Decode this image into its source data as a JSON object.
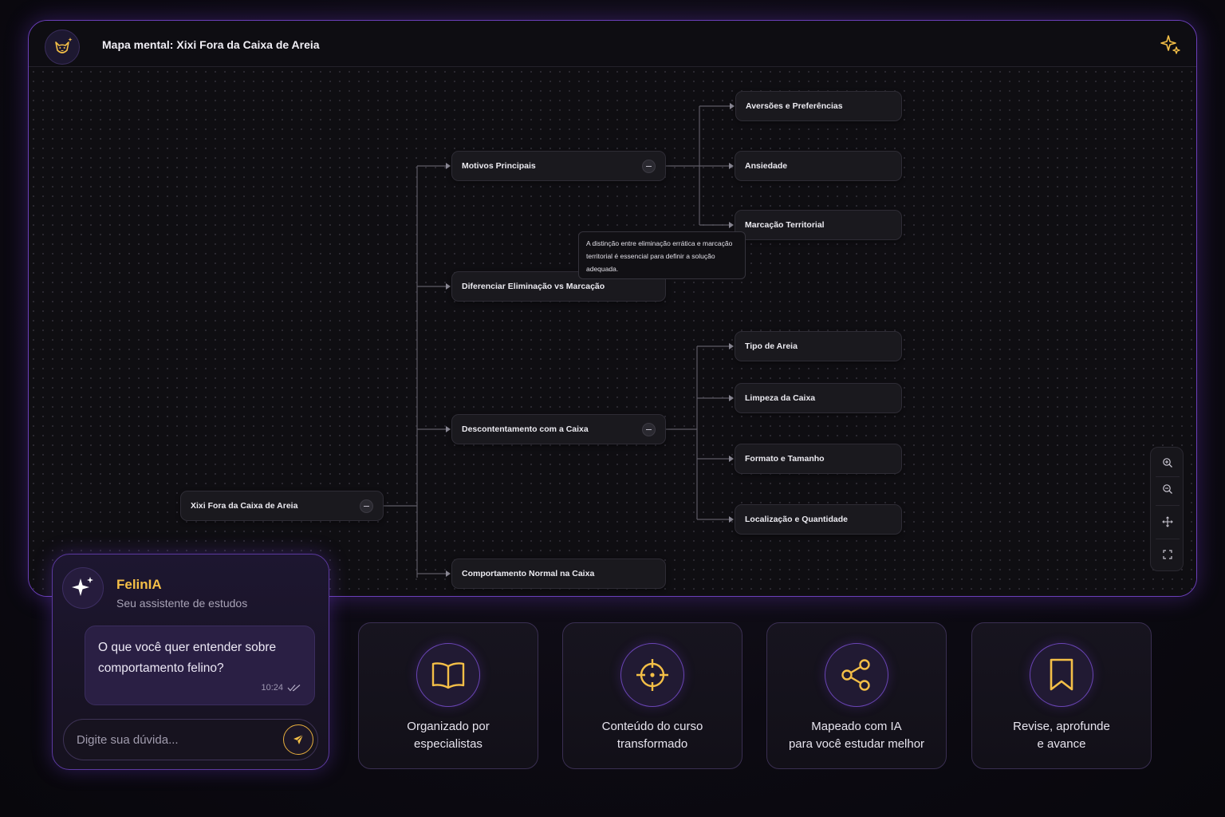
{
  "window": {
    "title": "Mapa mental: Xixi Fora da Caixa de Areia"
  },
  "mindmap": {
    "root": "Xixi Fora da Caixa de Areia",
    "branches": {
      "motivos": "Motivos Principais",
      "diferenciar": "Diferenciar Eliminação vs Marcação",
      "descontentamento": "Descontentamento com a Caixa",
      "comportamento": "Comportamento Normal na Caixa"
    },
    "leaves": {
      "aversoes": "Aversões e Preferências",
      "ansiedade": "Ansiedade",
      "marcacao": "Marcação Territorial",
      "tipo": "Tipo de Areia",
      "limpeza": "Limpeza da Caixa",
      "formato": "Formato e Tamanho",
      "localizacao": "Localização e Quantidade"
    },
    "tooltip": "A distinção entre eliminação errática e marcação territorial é essencial para definir a solução adequada."
  },
  "chat": {
    "name": "FelinIA",
    "subtitle": "Seu assistente de estudos",
    "message": "O que você quer entender sobre comportamento felino?",
    "time": "10:24",
    "placeholder": "Digite sua dúvida..."
  },
  "features": [
    {
      "icon": "book-open-icon",
      "label": "Organizado por\nespecialistas"
    },
    {
      "icon": "crosshair-icon",
      "label": "Conteúdo do curso\ntransformado"
    },
    {
      "icon": "share-nodes-icon",
      "label": "Mapeado com IA\npara você estudar melhor"
    },
    {
      "icon": "bookmark-icon",
      "label": "Revise, aprofunde\ne avance"
    }
  ],
  "colors": {
    "accent_gold": "#f4bf47",
    "accent_purple": "#6a3fb8"
  }
}
